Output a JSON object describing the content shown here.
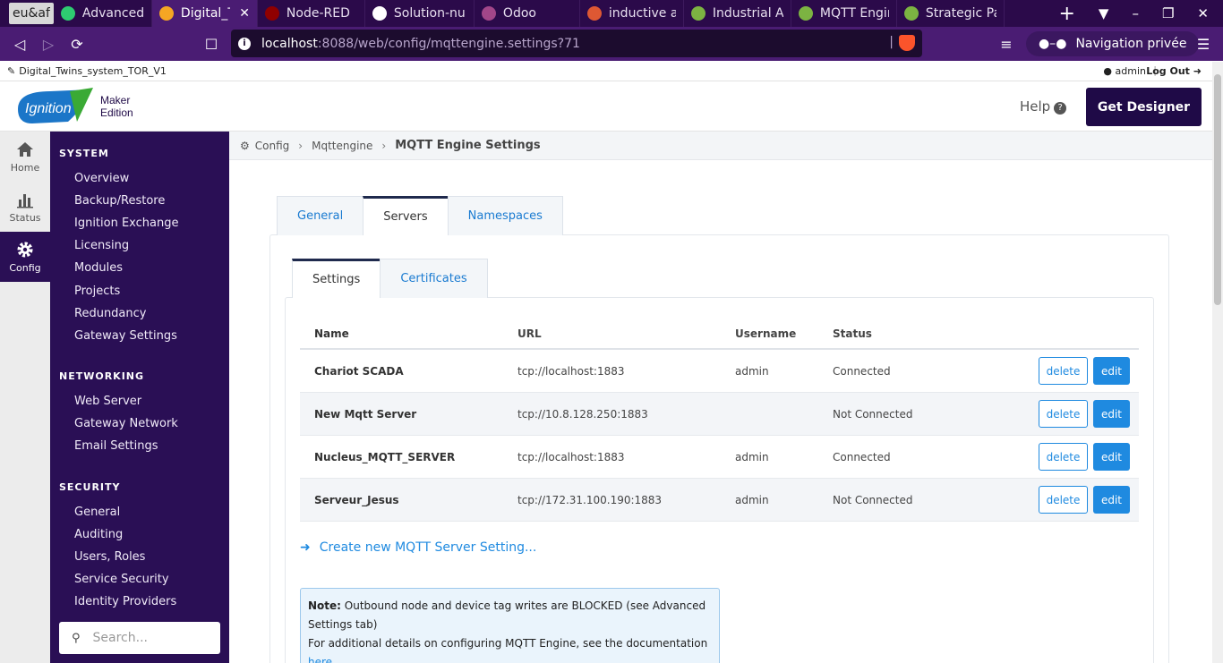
{
  "browser": {
    "tabs": [
      {
        "label": "eu&af",
        "icon": "",
        "active": false,
        "first": true
      },
      {
        "label": "Advanced - N",
        "icon": "x-icon",
        "color": "#2ecc71",
        "active": false
      },
      {
        "label": "Digital_Tw",
        "icon": "ignition-icon",
        "color": "#f5a623",
        "active": true
      },
      {
        "label": "Node-RED",
        "icon": "node-red-icon",
        "color": "#8f0000",
        "active": false
      },
      {
        "label": "Solution-nun",
        "icon": "github-icon",
        "color": "#ffffff",
        "active": false
      },
      {
        "label": "Odoo",
        "icon": "odoo-icon",
        "color": "#a24689",
        "active": false
      },
      {
        "label": "inductive au",
        "icon": "duckduckgo-icon",
        "color": "#de5833",
        "active": false
      },
      {
        "label": "Industrial Au",
        "icon": "gear-icon",
        "color": "#7cb342",
        "active": false
      },
      {
        "label": "MQTT Engin",
        "icon": "gear-icon",
        "color": "#7cb342",
        "active": false
      },
      {
        "label": "Strategic Pa",
        "icon": "gear-icon",
        "color": "#7cb342",
        "active": false
      }
    ],
    "url_host": "localhost",
    "url_rest": ":8088/web/config/mqttengine.settings?71",
    "private_label": "Navigation privée"
  },
  "topstrip": {
    "project": "Digital_Twins_system_TOR_V1",
    "user": "admin",
    "logout": "Log Out"
  },
  "header": {
    "logo_word": "Ignition",
    "logo_line1": "Maker",
    "logo_line2": "Edition",
    "help": "Help",
    "get_designer": "Get Designer"
  },
  "rail": {
    "items": [
      {
        "label": "Home",
        "icon": "home-icon"
      },
      {
        "label": "Status",
        "icon": "bar-chart-icon"
      },
      {
        "label": "Config",
        "icon": "gear-icon",
        "active": true
      }
    ]
  },
  "sidebar": {
    "sections": [
      {
        "heading": "SYSTEM",
        "items": [
          "Overview",
          "Backup/Restore",
          "Ignition Exchange",
          "Licensing",
          "Modules",
          "Projects",
          "Redundancy",
          "Gateway Settings"
        ]
      },
      {
        "heading": "NETWORKING",
        "items": [
          "Web Server",
          "Gateway Network",
          "Email Settings"
        ]
      },
      {
        "heading": "SECURITY",
        "items": [
          "General",
          "Auditing",
          "Users, Roles",
          "Service Security",
          "Identity Providers"
        ]
      }
    ],
    "search_placeholder": "Search..."
  },
  "breadcrumb": {
    "items": [
      "Config",
      "Mqttengine"
    ],
    "current": "MQTT Engine Settings"
  },
  "main": {
    "tabs": [
      "General",
      "Servers",
      "Namespaces"
    ],
    "active_tab": "Servers",
    "subtabs": [
      "Settings",
      "Certificates"
    ],
    "active_subtab": "Settings",
    "table": {
      "columns": [
        "Name",
        "URL",
        "Username",
        "Status"
      ],
      "rows": [
        {
          "name": "Chariot SCADA",
          "url": "tcp://localhost:1883",
          "username": "admin",
          "status": "Connected"
        },
        {
          "name": "New Mqtt Server",
          "url": "tcp://10.8.128.250:1883",
          "username": "",
          "status": "Not Connected"
        },
        {
          "name": "Nucleus_MQTT_SERVER",
          "url": "tcp://localhost:1883",
          "username": "admin",
          "status": "Connected"
        },
        {
          "name": "Serveur_Jesus",
          "url": "tcp://172.31.100.190:1883",
          "username": "admin",
          "status": "Not Connected"
        }
      ],
      "delete_label": "delete",
      "edit_label": "edit"
    },
    "create_link": "Create new MQTT Server Setting...",
    "note": {
      "bold": "Note:",
      "text1": " Outbound node and device tag writes are BLOCKED (see Advanced Settings tab)",
      "text2": "For additional details on configuring MQTT Engine, see the documentation",
      "link": "here"
    }
  }
}
